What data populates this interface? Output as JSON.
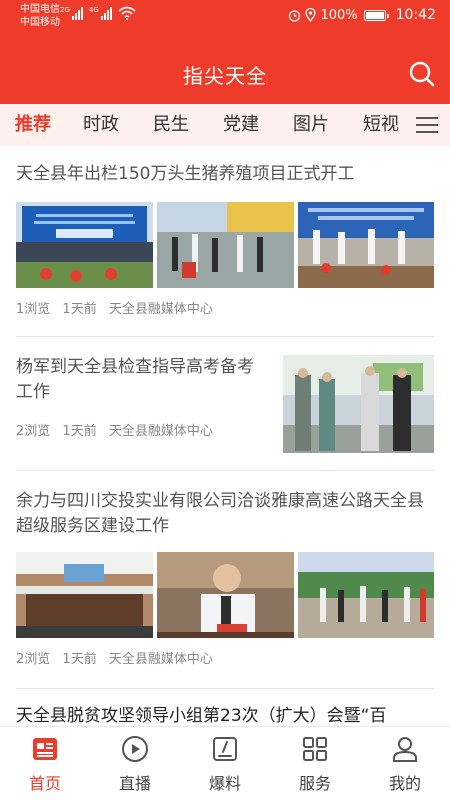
{
  "status_bar": {
    "carrier_1": "中国电信",
    "carrier_2": "中国移动",
    "network_1": "2G",
    "network_2": "4G",
    "battery": "100%",
    "time": "10:42"
  },
  "header": {
    "title": "指尖天全",
    "search_icon": "search-icon"
  },
  "tabs": [
    "推荐",
    "时政",
    "民生",
    "党建",
    "图片",
    "短视"
  ],
  "active_tab": "推荐",
  "articles": [
    {
      "title": "天全县年出栏150万头生猪养殖项目正式开工",
      "views": "1浏览",
      "time": "1天前",
      "source": "天全县融媒体中心",
      "images": [
        "groundbreaking-ceremony-photo",
        "ceremony-officials-photo",
        "shovel-groundbreaking-photo"
      ]
    },
    {
      "title": "杨军到天全县检查指导高考备考工作",
      "views": "2浏览",
      "time": "1天前",
      "source": "天全县融媒体中心",
      "images": [
        "school-inspection-photo"
      ]
    },
    {
      "title": "余力与四川交投实业有限公司洽谈雅康高速公路天全县超级服务区建设工作",
      "views": "2浏览",
      "time": "1天前",
      "source": "天全县融媒体中心",
      "images": [
        "meeting-room-photo",
        "official-speaking-photo",
        "site-visit-photo"
      ]
    },
    {
      "title": "天全县脱贫攻坚领导小组第23次（扩大）会暨“百"
    }
  ],
  "bottom_nav": [
    {
      "label": "首页",
      "icon": "home-news-icon"
    },
    {
      "label": "直播",
      "icon": "play-circle-icon"
    },
    {
      "label": "爆料",
      "icon": "report-edit-icon"
    },
    {
      "label": "服务",
      "icon": "grid-services-icon"
    },
    {
      "label": "我的",
      "icon": "user-icon"
    }
  ],
  "colors": {
    "brand": "#ef3c2a",
    "tab_background": "#fdf0ed",
    "meta_text": "#888888"
  }
}
